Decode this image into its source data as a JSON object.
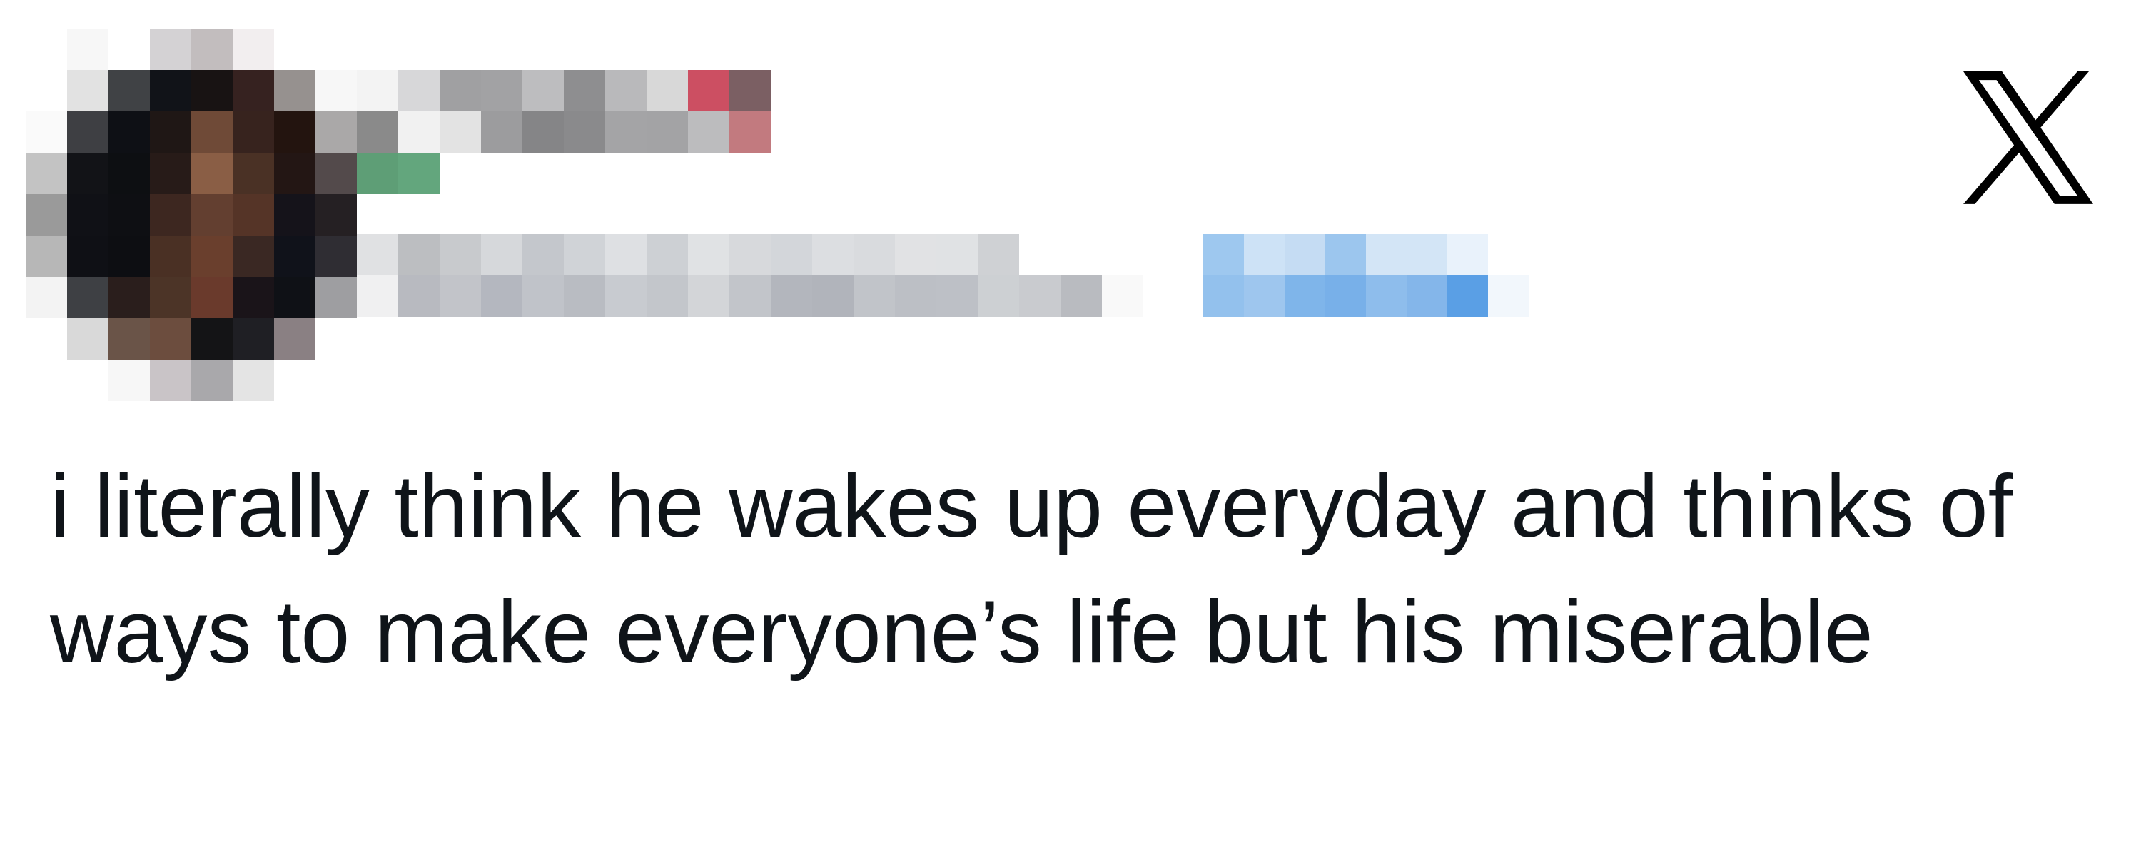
{
  "post": {
    "text": "i literally think he wakes up everyday and thinks of ways to make everyone’s life but his miserable",
    "platform_icon": "x-logo-icon"
  },
  "author": {
    "avatar": "avatar-pixelated",
    "name_redacted": true,
    "handle_redacted": true,
    "date_redacted": true
  },
  "colors": {
    "text": "#0f1419",
    "background": "#ffffff",
    "logo": "#000000"
  },
  "pixelation": {
    "avatar": [
      [
        "#ffffff",
        "#f7f7f7",
        "#ffffff",
        "#d4d2d4",
        "#c2bdbe",
        "#f2eeef",
        "#ffffff",
        "#ffffff"
      ],
      [
        "#ffffff",
        "#e2e2e2",
        "#404245",
        "#111318",
        "#181313",
        "#362220",
        "#96918f",
        "#f7f7f7"
      ],
      [
        "#fafafa",
        "#3e3f43",
        "#0e1015",
        "#1f1715",
        "#6f4a37",
        "#37231e",
        "#23140f",
        "#aaa8a8"
      ],
      [
        "#c3c3c3",
        "#121317",
        "#0d0f12",
        "#271b18",
        "#8a5e45",
        "#4a3125",
        "#231614",
        "#534a4b"
      ],
      [
        "#9a9a9a",
        "#101116",
        "#0e0f13",
        "#3d2720",
        "#633f30",
        "#553427",
        "#15131a",
        "#252023"
      ],
      [
        "#b7b7b7",
        "#0f1015",
        "#0d0e12",
        "#4a3024",
        "#6a3f2d",
        "#3a2823",
        "#10121a",
        "#2f2d33"
      ],
      [
        "#f3f3f3",
        "#3e4044",
        "#2a1e1c",
        "#4c3427",
        "#6a3a2c",
        "#1a1419",
        "#0f1116",
        "#9e9ea1"
      ],
      [
        "#ffffff",
        "#d9d9d9",
        "#6a5448",
        "#6c4d3e",
        "#141416",
        "#1f1f24",
        "#8a8083",
        "#ffffff"
      ],
      [
        "#ffffff",
        "#ffffff",
        "#f7f7f7",
        "#c9c4c7",
        "#a9a8ab",
        "#e4e4e4",
        "#ffffff",
        "#ffffff"
      ]
    ],
    "name": [
      [
        "#f3f3f3",
        "#d7d7d9",
        "#a0a0a2",
        "#a2a2a4",
        "#bdbdbf",
        "#8e8e90",
        "#b9b9bb",
        "#d8d8d8",
        "#cc4f62",
        "#7b5f63",
        "#8a8a8a"
      ],
      [
        "#f1f1f1",
        "#e3e3e3",
        "#9c9c9e",
        "#858587",
        "#8a8a8c",
        "#a4a4a6",
        "#a3a3a5",
        "#bcbcbe",
        "#c27a7f",
        "#5e9e76",
        "#63a67d"
      ]
    ],
    "handle": [
      [
        "#e0e1e3",
        "#bcbec1",
        "#c8cacd",
        "#d6d8db",
        "#c4c7cc",
        "#d0d3d7",
        "#dee0e3",
        "#cdd0d4",
        "#e0e2e4",
        "#d7d9dc",
        "#d3d6da",
        "#dcdee1",
        "#d9dbde",
        "#e1e2e4",
        "#e0e2e4",
        "#cfd1d4",
        "#ffffff",
        "#ffffff",
        "#ffffff"
      ],
      [
        "#f0f0f1",
        "#b8bac0",
        "#c2c4c9",
        "#b4b7bf",
        "#c0c3c9",
        "#b9bcc2",
        "#c8cbd0",
        "#c3c6cb",
        "#d3d5d8",
        "#c2c5ca",
        "#b3b6bd",
        "#b1b4bb",
        "#c1c4c9",
        "#bcbfc5",
        "#bdc0c6",
        "#cdd0d3",
        "#c9cbcf",
        "#b9bbc0",
        "#f9f9f9"
      ]
    ],
    "date": [
      [
        "#9ec8ef",
        "#cde2f6",
        "#c5dcf3",
        "#9cc6ee",
        "#d3e5f6",
        "#d3e5f6",
        "#e9f2fb",
        "#ffffff"
      ],
      [
        "#93c1ed",
        "#9ec6ee",
        "#7fb5ea",
        "#78b0e9",
        "#8ebdec",
        "#84b6ea",
        "#5a9fe5",
        "#f2f7fc"
      ]
    ]
  }
}
